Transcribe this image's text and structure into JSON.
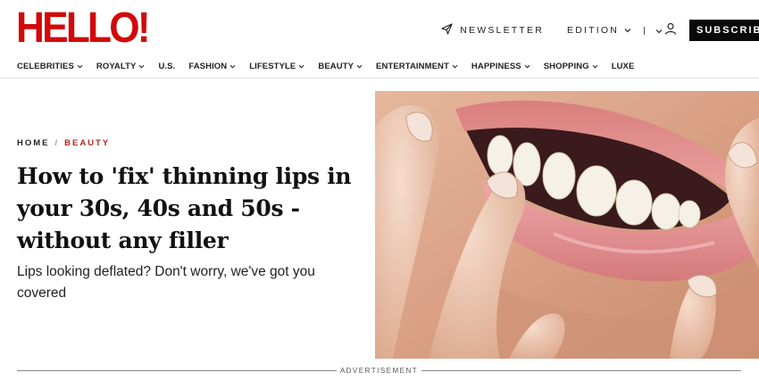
{
  "brand": {
    "logo_text": "HELLO!",
    "logo_color": "#d10a0a"
  },
  "header": {
    "newsletter_label": "NEWSLETTER",
    "edition_label": "EDITION",
    "separator": "I",
    "subscribe_label": "SUBSCRIBE"
  },
  "nav": {
    "items": [
      {
        "label": "CELEBRITIES",
        "has_dropdown": true
      },
      {
        "label": "ROYALTY",
        "has_dropdown": true
      },
      {
        "label": "U.S.",
        "has_dropdown": false
      },
      {
        "label": "FASHION",
        "has_dropdown": true
      },
      {
        "label": "LIFESTYLE",
        "has_dropdown": true
      },
      {
        "label": "BEAUTY",
        "has_dropdown": true
      },
      {
        "label": "ENTERTAINMENT",
        "has_dropdown": true
      },
      {
        "label": "HAPPINESS",
        "has_dropdown": true
      },
      {
        "label": "SHOPPING",
        "has_dropdown": true
      },
      {
        "label": "LUXE",
        "has_dropdown": false
      }
    ]
  },
  "article": {
    "breadcrumb": {
      "home": "HOME",
      "separator": "/",
      "category": "BEAUTY",
      "category_color": "#b3261e"
    },
    "headline": "How to 'fix' thinning lips in your 30s, 40s and 50s - without any filler",
    "standfirst": "Lips looking deflated? Don't worry, we've got you covered",
    "hero_image": "smiling-lips-close-up"
  },
  "advertisement_label": "ADVERTISEMENT"
}
